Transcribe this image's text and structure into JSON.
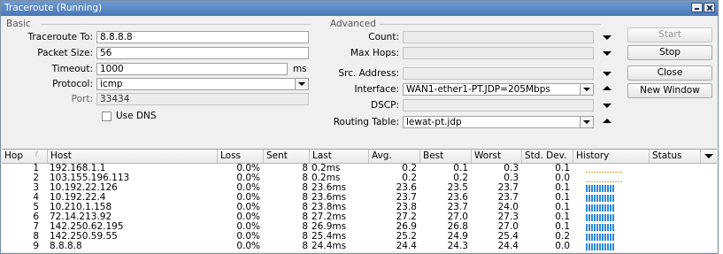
{
  "window": {
    "title": "Traceroute (Running)"
  },
  "basic": {
    "group_label": "Basic",
    "traceroute_to_label": "Traceroute To:",
    "traceroute_to_value": "8.8.8.8",
    "packet_size_label": "Packet Size:",
    "packet_size_value": "56",
    "timeout_label": "Timeout:",
    "timeout_value": "1000",
    "timeout_unit": "ms",
    "protocol_label": "Protocol:",
    "protocol_value": "icmp",
    "port_label": "Port:",
    "port_value": "33434",
    "use_dns_label": "Use DNS",
    "use_dns_checked": false
  },
  "advanced": {
    "group_label": "Advanced",
    "count_label": "Count:",
    "count_value": "",
    "max_hops_label": "Max Hops:",
    "max_hops_value": "",
    "src_address_label": "Src. Address:",
    "src_address_value": "",
    "interface_label": "Interface:",
    "interface_value": "WAN1-ether1-PT.JDP=205Mbps",
    "dscp_label": "DSCP:",
    "dscp_value": "",
    "routing_table_label": "Routing Table:",
    "routing_table_value": "lewat-pt.jdp"
  },
  "buttons": {
    "start": "Start",
    "stop": "Stop",
    "close": "Close",
    "new_window": "New Window"
  },
  "table": {
    "columns": [
      "Hop",
      "Host",
      "Loss",
      "Sent",
      "Last",
      "Avg.",
      "Best",
      "Worst",
      "Std. Dev.",
      "History",
      "Status"
    ],
    "rows": [
      {
        "hop": "1",
        "host": "192.168.1.1",
        "loss": "0.0%",
        "sent": "8",
        "last": "0.2ms",
        "avg": "0.2",
        "best": "0.1",
        "worst": "0.3",
        "std": "0.1",
        "history": "low"
      },
      {
        "hop": "2",
        "host": "103.155.196.113",
        "loss": "0.0%",
        "sent": "8",
        "last": "0.2ms",
        "avg": "0.2",
        "best": "0.2",
        "worst": "0.3",
        "std": "0.0",
        "history": "low"
      },
      {
        "hop": "3",
        "host": "10.192.22.126",
        "loss": "0.0%",
        "sent": "8",
        "last": "23.6ms",
        "avg": "23.6",
        "best": "23.5",
        "worst": "23.7",
        "std": "0.1",
        "history": "high"
      },
      {
        "hop": "4",
        "host": "10.192.22.4",
        "loss": "0.0%",
        "sent": "8",
        "last": "23.6ms",
        "avg": "23.7",
        "best": "23.6",
        "worst": "23.7",
        "std": "0.1",
        "history": "high"
      },
      {
        "hop": "5",
        "host": "10.210.1.158",
        "loss": "0.0%",
        "sent": "8",
        "last": "23.8ms",
        "avg": "23.8",
        "best": "23.7",
        "worst": "24.0",
        "std": "0.1",
        "history": "high"
      },
      {
        "hop": "6",
        "host": "72.14.213.92",
        "loss": "0.0%",
        "sent": "8",
        "last": "27.2ms",
        "avg": "27.2",
        "best": "27.0",
        "worst": "27.3",
        "std": "0.1",
        "history": "high"
      },
      {
        "hop": "7",
        "host": "142.250.62.195",
        "loss": "0.0%",
        "sent": "8",
        "last": "26.9ms",
        "avg": "26.9",
        "best": "26.8",
        "worst": "27.0",
        "std": "0.1",
        "history": "high"
      },
      {
        "hop": "8",
        "host": "142.250.59.55",
        "loss": "0.0%",
        "sent": "8",
        "last": "25.4ms",
        "avg": "25.2",
        "best": "24.9",
        "worst": "25.4",
        "std": "0.2",
        "history": "high"
      },
      {
        "hop": "9",
        "host": "8.8.8.8",
        "loss": "0.0%",
        "sent": "8",
        "last": "24.4ms",
        "avg": "24.4",
        "best": "24.3",
        "worst": "24.4",
        "std": "0.0",
        "history": "high"
      }
    ]
  },
  "colors": {
    "titlebar": "#4a78b6",
    "history_bar": "#2e88d8",
    "history_low": "#e0a030"
  }
}
